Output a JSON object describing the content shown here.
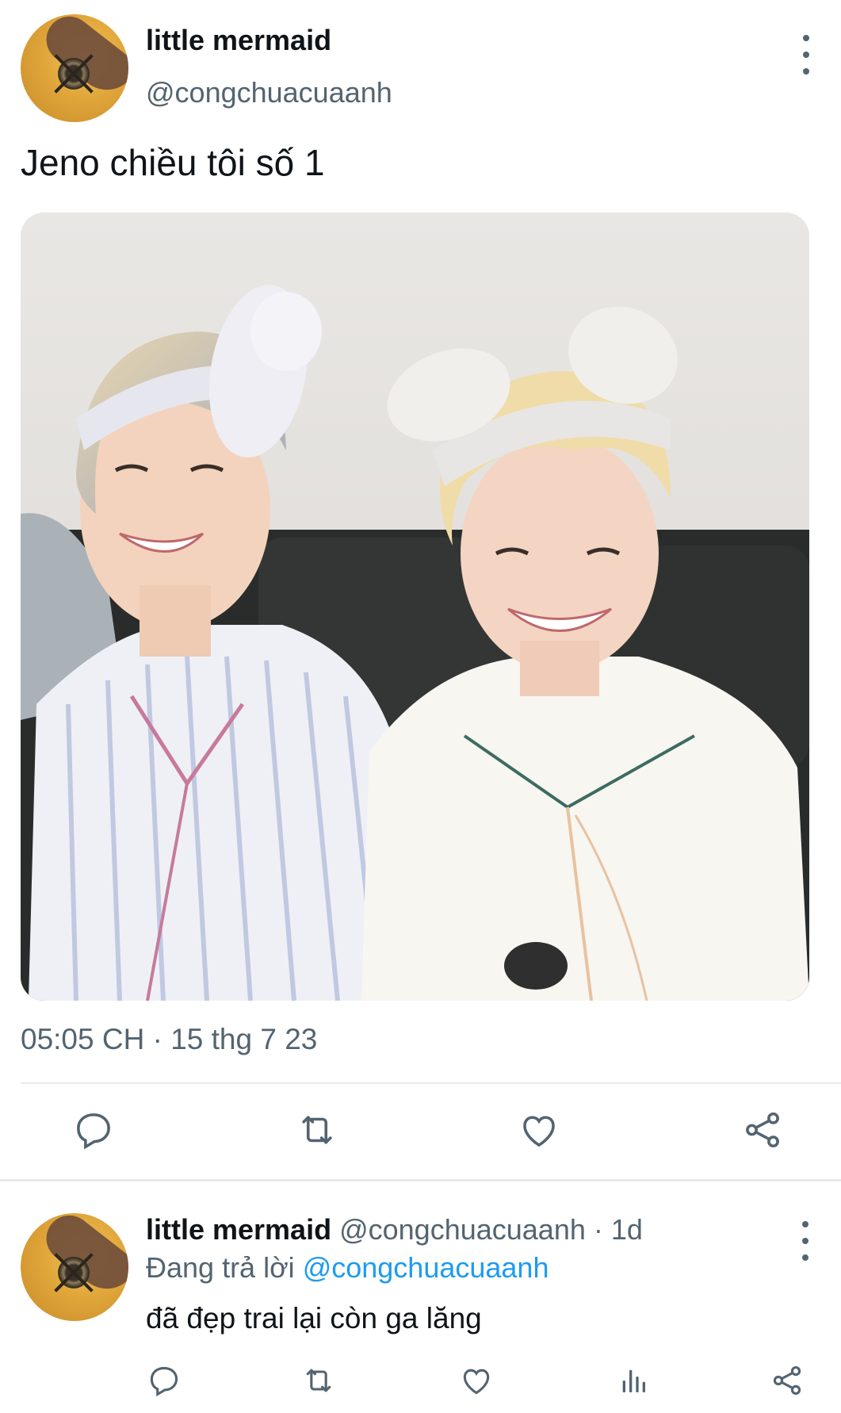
{
  "tweet": {
    "author": {
      "display_name": "little mermaid",
      "handle": "@congchuacuaanh",
      "avatar_icon": "avatar-icon"
    },
    "text": "Jeno chiều tôi số 1",
    "timestamp": "05:05 CH · 15 thg 7 23",
    "actions": [
      "reply-icon",
      "retweet-icon",
      "like-icon",
      "share-icon"
    ]
  },
  "reply": {
    "display_name": "little mermaid",
    "handle_time": "@congchuacuaanh · 1d",
    "replying_to_prefix": "Đang trả lời ",
    "replying_to_mention": "@congchuacuaanh",
    "text": "đã đẹp trai lại còn ga lăng",
    "actions": [
      "reply-icon",
      "retweet-icon",
      "like-icon",
      "views-icon",
      "share-icon"
    ]
  },
  "colors": {
    "text_primary": "#0f1419",
    "text_secondary": "#536471",
    "link": "#1d9bf0",
    "divider": "#e7e9ea"
  }
}
